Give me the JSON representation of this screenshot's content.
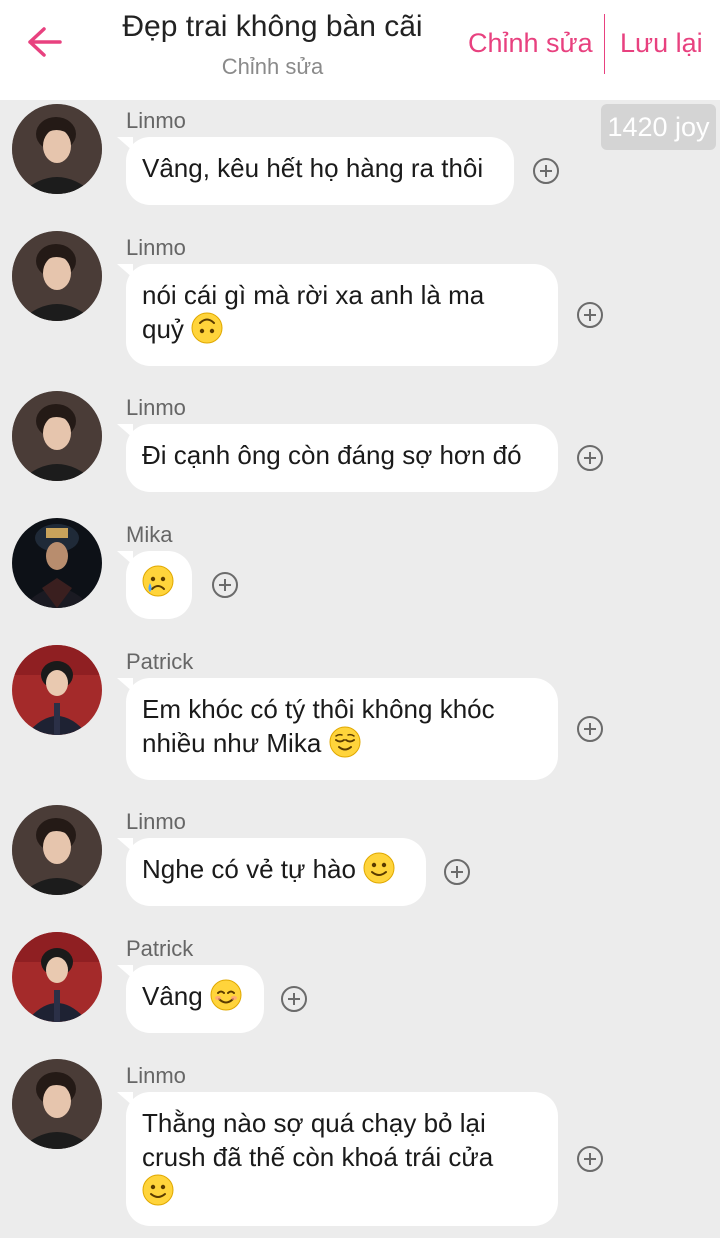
{
  "header": {
    "title": "Đẹp trai không bàn cãi",
    "subtitle": "Chỉnh sửa",
    "edit_label": "Chỉnh sửa",
    "save_label": "Lưu lại",
    "accent_color": "#e8417f"
  },
  "joy_badge": "1420 joy",
  "messages": [
    {
      "sender": "Linmo",
      "avatar": "linmo",
      "lines": [
        "Vâng, kêu hết họ hàng ra thôi"
      ],
      "emoji": ""
    },
    {
      "sender": "Linmo",
      "avatar": "linmo",
      "lines": [
        "nói cái gì mà rời xa anh là ma",
        "quỷ"
      ],
      "emoji": "upside-down-face"
    },
    {
      "sender": "Linmo",
      "avatar": "linmo",
      "lines": [
        "Đi cạnh ông còn đáng sợ hơn đó"
      ],
      "emoji": ""
    },
    {
      "sender": "Mika",
      "avatar": "mika",
      "lines": [
        ""
      ],
      "emoji": "sad-sweat-face"
    },
    {
      "sender": "Patrick",
      "avatar": "patrick",
      "lines": [
        "Em khóc có tý thôi không khóc",
        "nhiều như Mika"
      ],
      "emoji": "relieved-face"
    },
    {
      "sender": "Linmo",
      "avatar": "linmo",
      "lines": [
        "Nghe có vẻ tự hào"
      ],
      "emoji": "slightly-smiling-face"
    },
    {
      "sender": "Patrick",
      "avatar": "patrick",
      "lines": [
        "Vâng"
      ],
      "emoji": "smiling-face"
    },
    {
      "sender": "Linmo",
      "avatar": "linmo",
      "lines": [
        "Thằng nào sợ quá chạy bỏ lại",
        "crush đã thế còn khoá trái cửa",
        ""
      ],
      "emoji": "slightly-smiling-face"
    }
  ]
}
